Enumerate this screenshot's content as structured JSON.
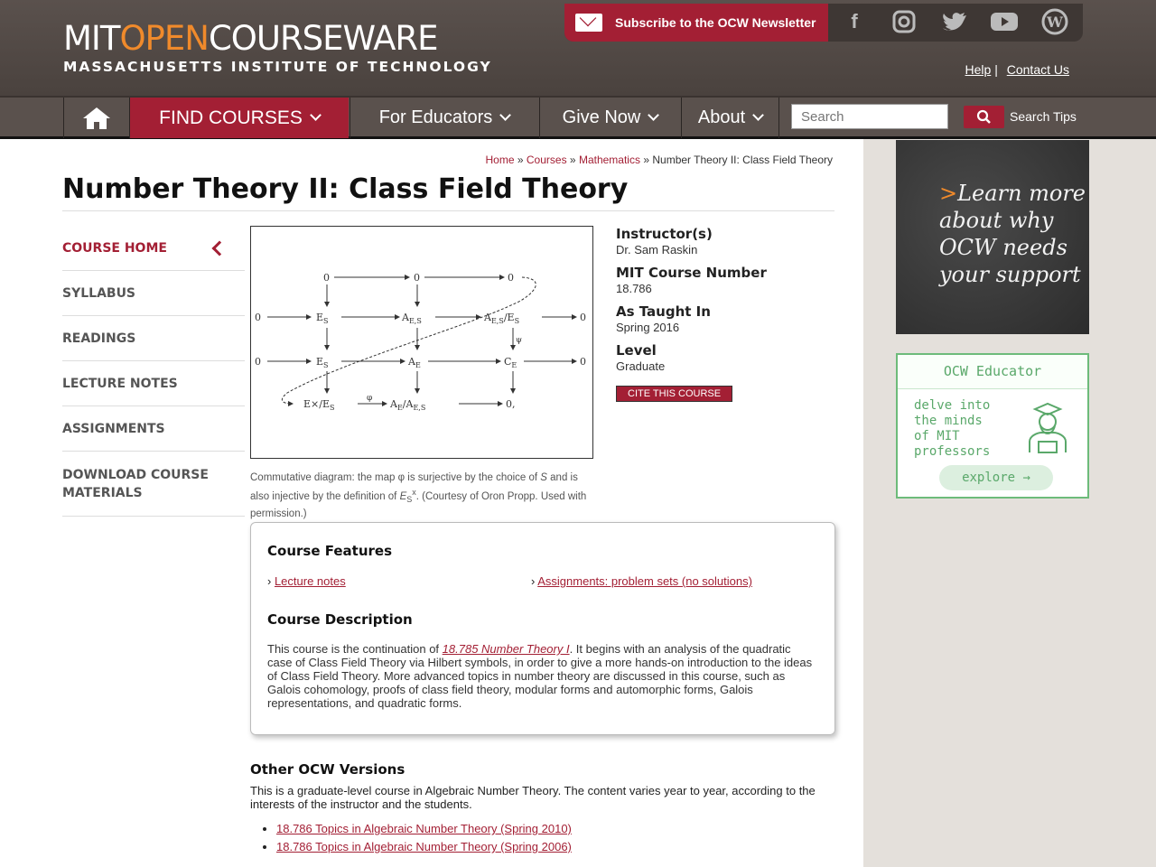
{
  "header": {
    "logo_mit": "MIT",
    "logo_open": "OPEN",
    "logo_courseware": "COURSEWARE",
    "logo_sub": "MASSACHUSETTS INSTITUTE OF TECHNOLOGY",
    "subscribe_label": "Subscribe to the OCW Newsletter",
    "help_label": "Help",
    "contact_label": "Contact Us",
    "social_icons": [
      "facebook-icon",
      "instagram-icon",
      "twitter-icon",
      "youtube-icon",
      "wordpress-icon"
    ]
  },
  "nav": {
    "find_courses": "FIND COURSES",
    "for_educators": "For Educators",
    "give_now": "Give Now",
    "about": "About",
    "search_placeholder": "Search",
    "search_tips": "Search Tips"
  },
  "breadcrumb": {
    "home": "Home",
    "courses": "Courses",
    "mathematics": "Mathematics",
    "current": "Number Theory II: Class Field Theory",
    "sep": "»"
  },
  "page": {
    "title": "Number Theory II: Class Field Theory"
  },
  "leftnav": {
    "items": [
      "COURSE HOME",
      "SYLLABUS",
      "READINGS",
      "LECTURE NOTES",
      "ASSIGNMENTS",
      "DOWNLOAD COURSE MATERIALS"
    ]
  },
  "figure": {
    "caption_1": "Commutative diagram: the map φ is surjective by the choice of ",
    "caption_s": "S",
    "caption_2": " and is also injective by the definition of ",
    "caption_es": "E",
    "caption_es_sub": "S",
    "caption_es_sup": "x",
    "caption_3": ". (Courtesy of Oron Propp. Used with permission.)"
  },
  "course_info": {
    "instructor_label": "Instructor(s)",
    "instructor_value": "Dr. Sam Raskin",
    "number_label": "MIT Course Number",
    "number_value": "18.786",
    "taught_label": "As Taught In",
    "taught_value": "Spring 2016",
    "level_label": "Level",
    "level_value": "Graduate",
    "cite_label": "CITE THIS COURSE"
  },
  "features": {
    "heading": "Course Features",
    "items": [
      "Lecture notes",
      "Assignments: problem sets (no solutions)"
    ],
    "description_heading": "Course Description",
    "desc_pre": "This course is the continuation of ",
    "desc_link": "18.785 Number Theory I",
    "desc_post": ". It begins with an analysis of the quadratic case of Class Field Theory via Hilbert symbols, in order to give a more hands-on introduction to the ideas of Class Field Theory. More advanced topics in number theory are discussed in this course, such as Galois cohomology, proofs of class field theory, modular forms and automorphic forms, Galois representations, and quadratic forms."
  },
  "other_versions": {
    "heading": "Other OCW Versions",
    "text": "This is a graduate-level course in Algebraic Number Theory. The content varies year to year, according to the interests of the instructor and the students.",
    "links": [
      "18.786 Topics in Algebraic Number Theory (Spring 2010)",
      "18.786 Topics in Algebraic Number Theory (Spring 2006)"
    ]
  },
  "sidebar": {
    "chalk_arrow": ">",
    "chalk_lines": [
      "Learn more",
      "about why",
      "OCW needs",
      "your support"
    ],
    "educator_heading": "OCW Educator",
    "educator_lines": [
      "delve into",
      "the minds",
      "of MIT",
      "professors"
    ],
    "explore_label": "explore →"
  },
  "colors": {
    "brand_red": "#a31f34",
    "header_brown": "#5a514d",
    "accent_orange": "#f08a2b",
    "educator_green": "#5aa86a"
  }
}
